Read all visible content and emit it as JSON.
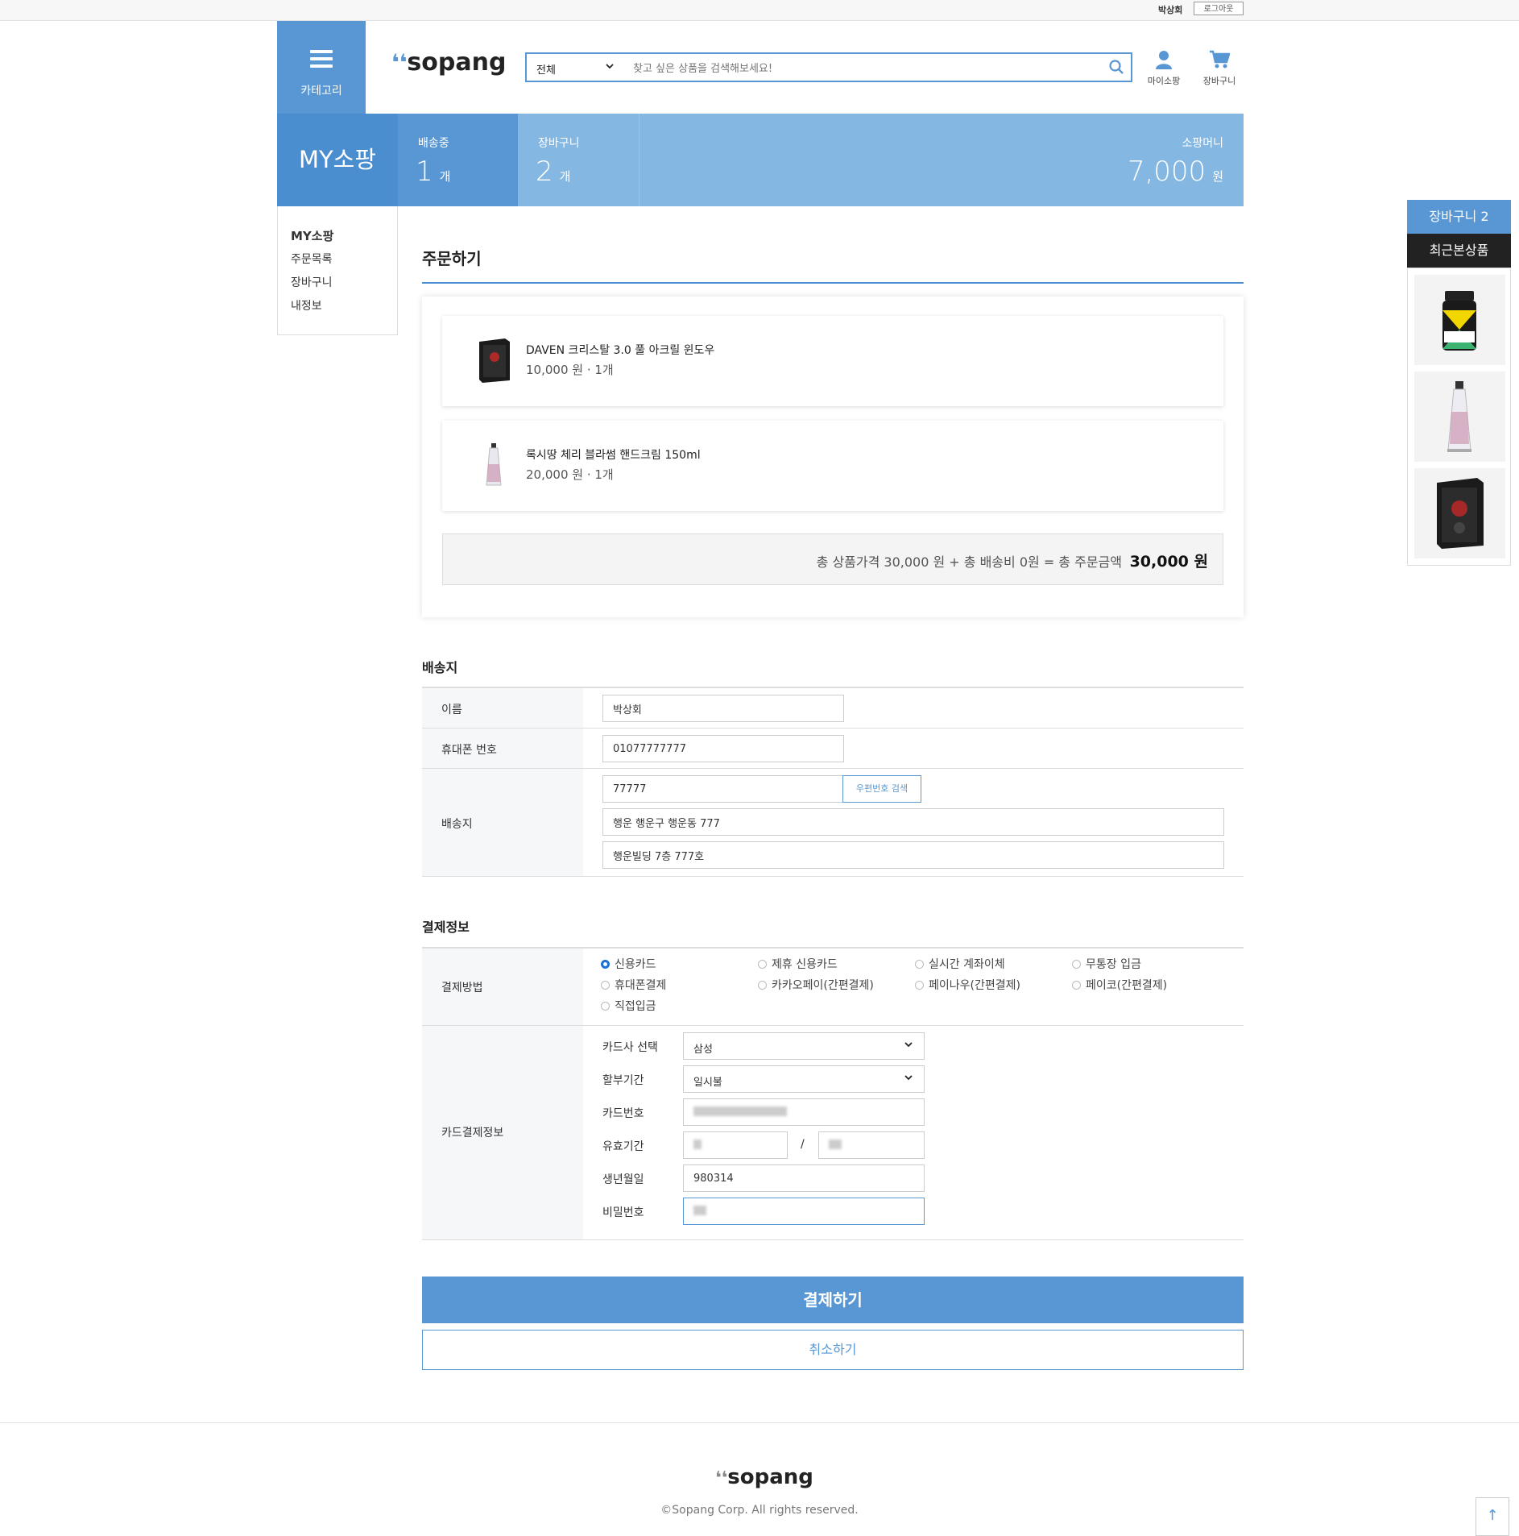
{
  "topbar": {
    "user_name": "박상회",
    "logout_label": "로그아웃"
  },
  "header": {
    "category_label": "카테고리",
    "logo_text": "sopang",
    "search_category": "전체",
    "search_placeholder": "찾고 싶은 상품을 검색해보세요!",
    "mysopang_label": "마이소팡",
    "cart_label": "장바구니"
  },
  "summary": {
    "title": "MY소팡",
    "shipping_label": "배송중",
    "shipping_count": "1",
    "cart_label": "장바구니",
    "cart_count": "2",
    "unit": "개",
    "money_label": "소팡머니",
    "money_value": "7,000",
    "money_unit": "원"
  },
  "sidenav": {
    "title": "MY소팡",
    "items": [
      "주문목록",
      "장바구니",
      "내정보"
    ]
  },
  "right_panel": {
    "cart_label": "장바구니 2",
    "recent_label": "최근본상품"
  },
  "order": {
    "title": "주문하기",
    "items": [
      {
        "name": "DAVEN 크리스탈 3.0 풀 아크릴 윈도우",
        "price": "10,000 원 · 1개"
      },
      {
        "name": "록시땅 체리 블라썸 핸드크림 150ml",
        "price": "20,000 원 · 1개"
      }
    ],
    "total_desc": "총 상품가격 30,000 원 + 총 배송비 0원 = 총 주문금액",
    "total_amount": "30,000 원"
  },
  "delivery": {
    "section_title": "배송지",
    "name_label": "이름",
    "name_value": "박상회",
    "phone_label": "휴대폰 번호",
    "phone_value": "01077777777",
    "address_label": "배송지",
    "zipcode": "77777",
    "zip_button": "우편번호 검색",
    "address1": "행운 행운구 행운동 777",
    "address2": "행운빌딩 7층 777호"
  },
  "payment": {
    "section_title": "결제정보",
    "method_label": "결제방법",
    "methods": [
      "신용카드",
      "제휴 신용카드",
      "실시간 계좌이체",
      "무통장 입금",
      "휴대폰결제",
      "카카오페이(간편결제)",
      "페이나우(간편결제)",
      "페이코(간편결제)",
      "직접입금"
    ],
    "selected_method": "신용카드",
    "card_info_label": "카드결제정보",
    "card_company_label": "카드사 선택",
    "card_company_value": "삼성",
    "installment_label": "할부기간",
    "installment_value": "일시불",
    "card_number_label": "카드번호",
    "expiry_label": "유효기간",
    "expiry_separator": "/",
    "birth_label": "생년월일",
    "birth_value": "980314",
    "password_label": "비밀번호"
  },
  "actions": {
    "pay_label": "결제하기",
    "cancel_label": "취소하기"
  },
  "footer": {
    "logo_text": "sopang",
    "copyright": "©Sopang Corp. All rights reserved."
  },
  "colors": {
    "primary": "#5897d3",
    "primary_dark": "#4a8ed0",
    "primary_light": "#84b7e1",
    "dark": "#222222"
  }
}
